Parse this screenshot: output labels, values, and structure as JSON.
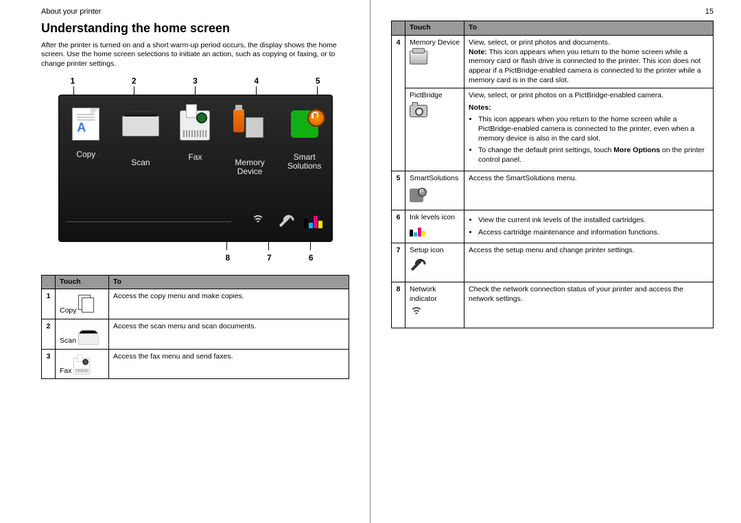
{
  "header": {
    "left": "About your printer",
    "page_no": "15"
  },
  "heading": "Understanding the home screen",
  "intro": "After the printer is turned on and a short warm-up period occurs, the display shows the home screen. Use the home screen selections to initiate an action, such as copying or faxing, or to change printer settings.",
  "callouts_top": [
    "1",
    "2",
    "3",
    "4",
    "5"
  ],
  "callouts_bottom": [
    "8",
    "7",
    "6"
  ],
  "screen_icons": [
    {
      "label": "Copy"
    },
    {
      "label": "Scan"
    },
    {
      "label": "Fax"
    },
    {
      "label": "Memory\nDevice"
    },
    {
      "label": "Smart\nSolutions"
    }
  ],
  "table_headers": {
    "col1": "",
    "col2": "Touch",
    "col3": "To"
  },
  "left_rows": [
    {
      "n": "1",
      "touch": "Copy",
      "to": "Access the copy menu and make copies."
    },
    {
      "n": "2",
      "touch": "Scan",
      "to": "Access the scan menu and scan documents."
    },
    {
      "n": "3",
      "touch": "Fax",
      "to": "Access the fax menu and send faxes."
    }
  ],
  "right_rows": {
    "r4": {
      "n": "4",
      "touch": "Memory Device",
      "to_line": "View, select, or print photos and documents.",
      "note_label": "Note:",
      "note_text": " This icon appears when you return to the home screen while a memory card or flash drive is connected to the printer. This icon does not appear if a PictBridge-enabled camera is connected to the printer while a memory card is in the card slot."
    },
    "r4b": {
      "touch": "PictBridge",
      "to_line": "View, select, or print photos on a PictBridge-enabled camera.",
      "notes_label": "Notes:",
      "bullet1": "This icon appears when you return to the home screen while a PictBridge-enabled camera is connected to the printer, even when a memory device is also in the card slot.",
      "bullet2_pre": "To change the default print settings, touch ",
      "bullet2_bold": "More Options",
      "bullet2_post": " on the printer control panel."
    },
    "r5": {
      "n": "5",
      "touch": "SmartSolutions",
      "to": "Access the SmartSolutions menu."
    },
    "r6": {
      "n": "6",
      "touch": "Ink levels icon",
      "bullet1": "View the current ink levels of the installed cartridges.",
      "bullet2": "Access cartridge maintenance and information functions."
    },
    "r7": {
      "n": "7",
      "touch": "Setup icon",
      "to": "Access the setup menu and change printer settings."
    },
    "r8": {
      "n": "8",
      "touch": "Network indicator",
      "to": "Check the network connection status of your printer and access the network settings."
    }
  }
}
